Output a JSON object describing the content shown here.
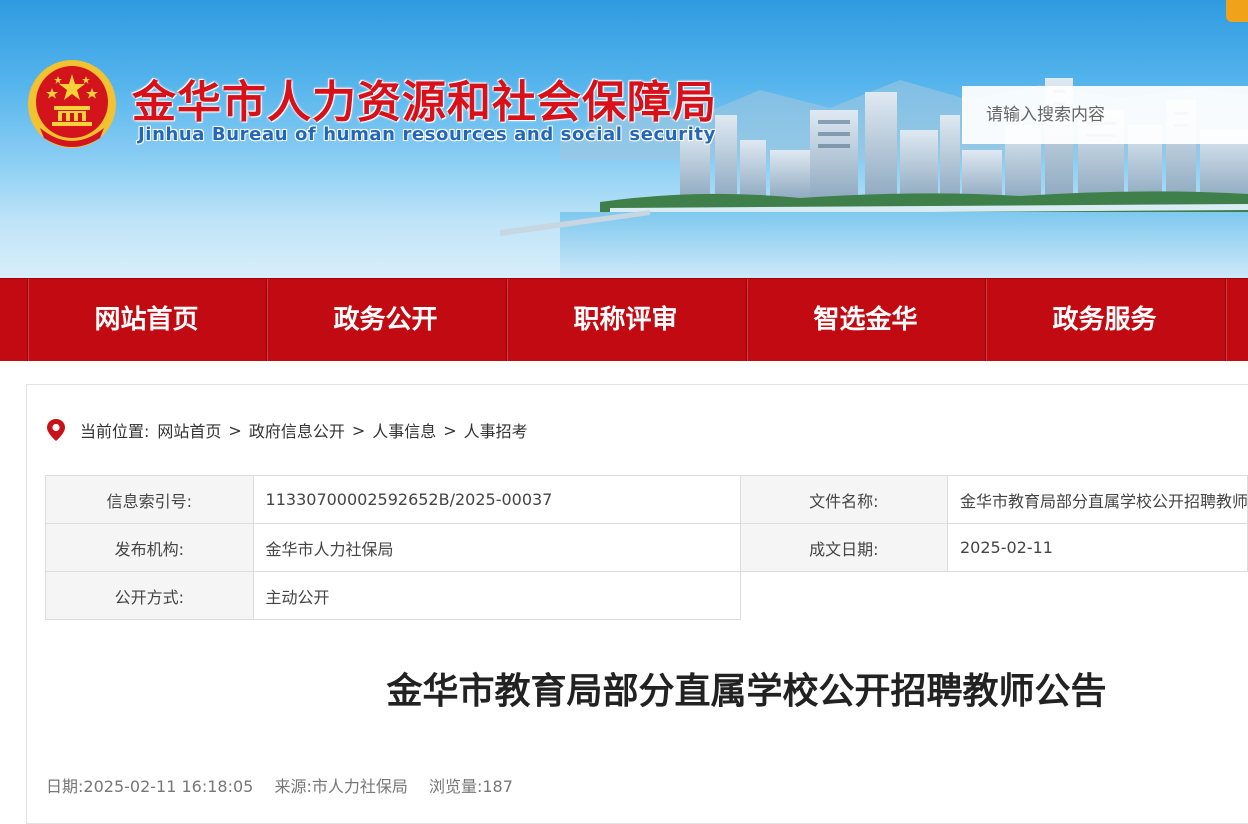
{
  "header": {
    "title_cn": "金华市人力资源和社会保障局",
    "title_en": "Jinhua Bureau of human resources and social security",
    "search_placeholder": "请输入搜索内容",
    "emblem_icon": "national-emblem-icon",
    "colors": {
      "brand_red": "#c10a11",
      "title_red": "#d8101a",
      "title_blue": "#2567b7",
      "sky": "#55b4ec"
    }
  },
  "nav": {
    "items": [
      {
        "label": "网站首页"
      },
      {
        "label": "政务公开"
      },
      {
        "label": "职称评审"
      },
      {
        "label": "智选金华"
      },
      {
        "label": "政务服务"
      }
    ]
  },
  "breadcrumb": {
    "prefix": "当前位置:",
    "items": [
      "网站首页",
      "政府信息公开",
      "人事信息",
      "人事招考"
    ],
    "separator": ">",
    "icon": "location-pin-icon"
  },
  "meta": {
    "index_label": "信息索引号:",
    "index_value": "11330700002592652B/2025-00037",
    "doc_name_label": "文件名称:",
    "doc_name_value": "金华市教育局部分直属学校公开招聘教师公告",
    "publisher_label": "发布机构:",
    "publisher_value": "金华市人力社保局",
    "date_label": "成文日期:",
    "date_value": "2025-02-11",
    "method_label": "公开方式:",
    "method_value": "主动公开"
  },
  "article": {
    "title": "金华市教育局部分直属学校公开招聘教师公告",
    "date_label": "日期:",
    "date_value": "2025-02-11 16:18:05",
    "source_label": "来源:",
    "source_value": "市人力社保局",
    "views_label": "浏览量:",
    "views_value": "187"
  }
}
